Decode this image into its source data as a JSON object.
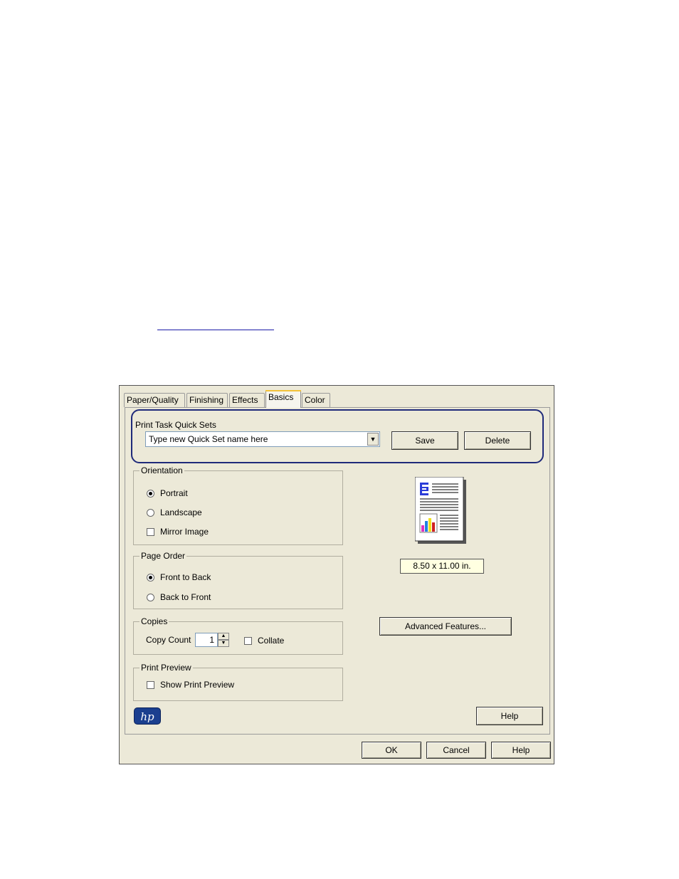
{
  "tabs": [
    "Paper/Quality",
    "Finishing",
    "Effects",
    "Basics",
    "Color"
  ],
  "active_tab": "Basics",
  "quick_sets": {
    "legend": "Print Task Quick Sets",
    "combo_value": "Type new Quick Set name here",
    "save_label": "Save",
    "delete_label": "Delete",
    "highlight_color": "#1f2a7a"
  },
  "orientation": {
    "legend": "Orientation",
    "portrait": "Portrait",
    "landscape": "Landscape",
    "mirror": "Mirror Image",
    "selected": "Portrait",
    "mirror_checked": false
  },
  "page_order": {
    "legend": "Page Order",
    "front_to_back": "Front to Back",
    "back_to_front": "Back to Front",
    "selected": "Front to Back"
  },
  "copies": {
    "legend": "Copies",
    "count_label": "Copy Count",
    "count_value": "1",
    "collate_label": "Collate",
    "collate_checked": false
  },
  "print_preview": {
    "legend": "Print Preview",
    "show_label": "Show Print Preview",
    "checked": false
  },
  "paper_size": "8.50 x 11.00 in.",
  "advanced_features_label": "Advanced Features...",
  "help_inner_label": "Help",
  "footer": {
    "ok_label": "OK",
    "cancel_label": "Cancel",
    "help_label": "Help"
  },
  "logo_text": "hp",
  "colors": {
    "dialog_bg": "#ece9d8",
    "tooltip_bg": "#ffffe1",
    "active_tab_accent": "#f3c23b",
    "logo_bg": "#1b3f8f"
  }
}
